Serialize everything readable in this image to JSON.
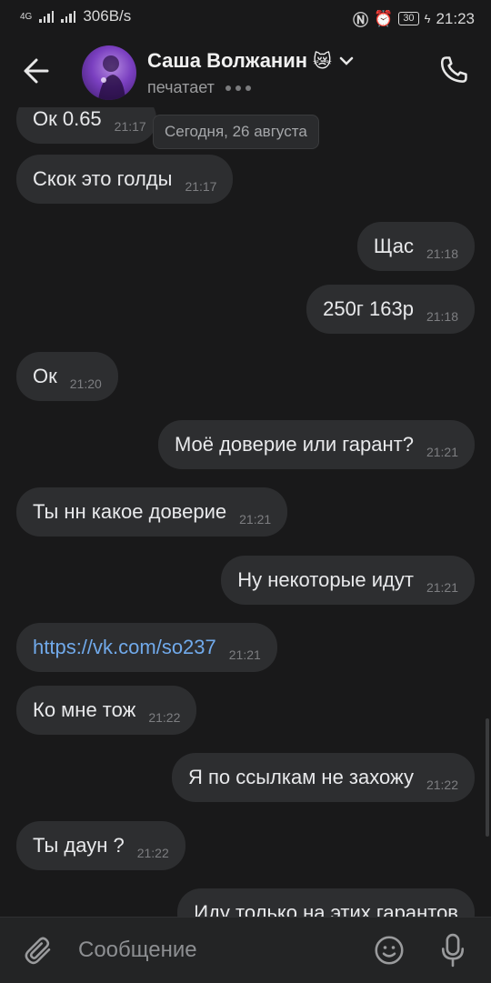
{
  "status_bar": {
    "network_left": "4G",
    "speed": "306B/s",
    "battery": "30",
    "time": "21:23"
  },
  "header": {
    "name": "Саша Волжанин",
    "name_emoji": "😿",
    "status": "печатает"
  },
  "date_divider": "Сегодня, 26 августа",
  "messages": [
    {
      "side": "in",
      "text": "Ок 0.65",
      "time": "21:17"
    },
    {
      "side": "in",
      "text": "Скок это голды",
      "time": "21:17"
    },
    {
      "side": "out",
      "text": "Щас",
      "time": "21:18"
    },
    {
      "side": "out",
      "text": "250г 163р",
      "time": "21:18"
    },
    {
      "side": "in",
      "text": "Ок",
      "time": "21:20"
    },
    {
      "side": "out",
      "text": "Моё доверие или гарант?",
      "time": "21:21"
    },
    {
      "side": "in",
      "text": "Ты нн какое доверие",
      "time": "21:21"
    },
    {
      "side": "out",
      "text": "Ну некоторые идут",
      "time": "21:21"
    },
    {
      "side": "in",
      "text": "https://vk.com/so237",
      "time": "21:21",
      "is_link": true
    },
    {
      "side": "in",
      "text": "Ко мне тож",
      "time": "21:22"
    },
    {
      "side": "out",
      "text": "Я по ссылкам не захожу",
      "time": "21:22"
    },
    {
      "side": "in",
      "text": "Ты даун ?",
      "time": "21:22"
    },
    {
      "side": "out",
      "text": "Иду только на этих гарантов",
      "time": ""
    }
  ],
  "input": {
    "placeholder": "Сообщение"
  },
  "icons": {
    "back": "back-arrow-icon",
    "call": "phone-icon",
    "attach": "paperclip-icon",
    "emoji": "emoji-icon",
    "mic": "microphone-icon"
  },
  "colors": {
    "background": "#19191a",
    "bubble": "#2d2e30",
    "link": "#71aaeb"
  }
}
